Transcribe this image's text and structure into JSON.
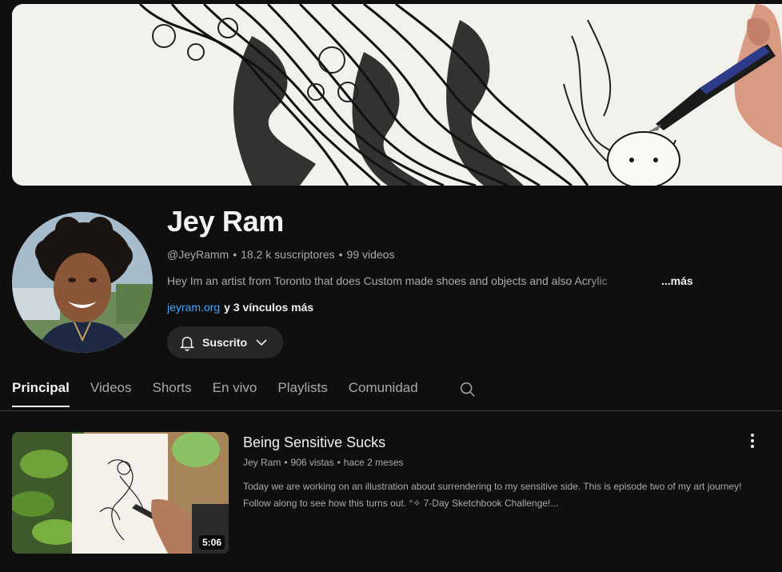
{
  "channel": {
    "name": "Jey Ram",
    "handle": "@JeyRamm",
    "subscribers": "18.2 k suscriptores",
    "videos_count": "99 videos",
    "description": "Hey Im an artist from Toronto that does Custom made shoes and objects and also Acrylic",
    "more_label": "...más",
    "link": "jeyram.org",
    "more_links": "y 3 vínculos más",
    "subscribe_label": "Suscrito"
  },
  "tabs": [
    {
      "label": "Principal",
      "active": true
    },
    {
      "label": "Videos"
    },
    {
      "label": "Shorts"
    },
    {
      "label": "En vivo"
    },
    {
      "label": "Playlists"
    },
    {
      "label": "Comunidad"
    }
  ],
  "video": {
    "title": "Being Sensitive Sucks",
    "author": "Jey Ram",
    "views": "906 vistas",
    "age": "hace 2 meses",
    "description": "Today we are working on an illustration about surrendering to my sensitive side. This is episode two of my art journey! Follow along to see how this turns out. °✧ 7-Day Sketchbook Challenge!...",
    "duration": "5:06"
  },
  "icons": {
    "bell": "bell-icon",
    "chevron": "chevron-down-icon",
    "search": "search-icon",
    "more": "more-vert-icon"
  },
  "colors": {
    "background": "#0f0f0f",
    "link": "#3ea6ff",
    "muted_text": "#aaaaaa",
    "button_bg": "#272727"
  }
}
